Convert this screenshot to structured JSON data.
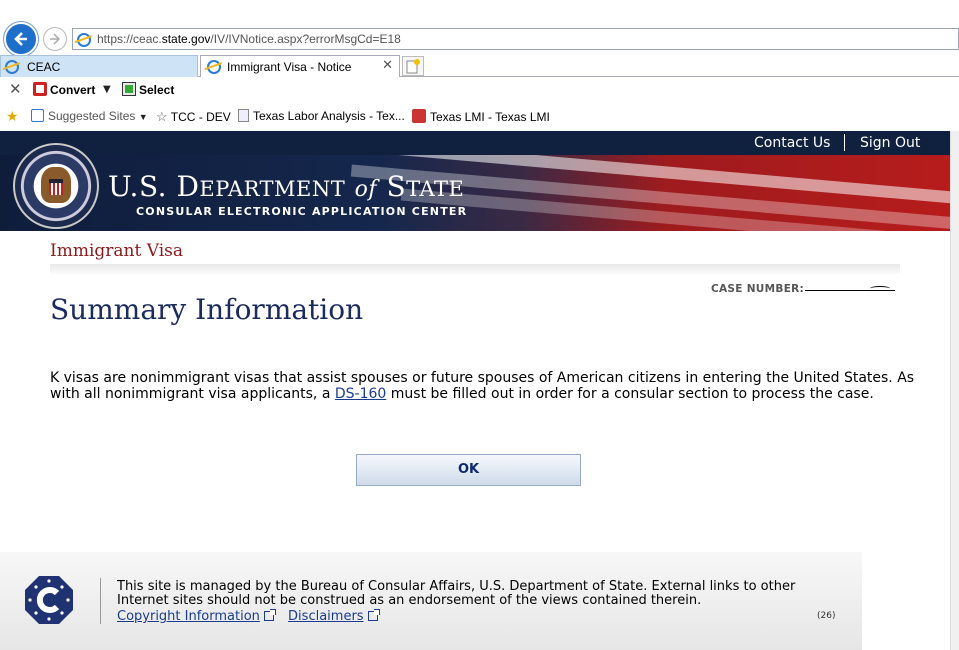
{
  "browser": {
    "url_prefix": "https://ceac.",
    "url_domain": "state.gov",
    "url_path": "/IV/IVNotice.aspx?errorMsgCd=E18",
    "tabs": [
      {
        "label": "CEAC"
      },
      {
        "label": "Immigrant Visa - Notice"
      }
    ],
    "toolbar": {
      "convert_label": "Convert",
      "select_label": "Select"
    },
    "favorites": [
      {
        "label": "Suggested Sites"
      },
      {
        "label": "TCC - DEV"
      },
      {
        "label": "Texas Labor Analysis - Tex..."
      },
      {
        "label": "Texas LMI - Texas LMI"
      }
    ]
  },
  "header": {
    "contact_label": "Contact Us",
    "signout_label": "Sign Out",
    "dept_u": "U",
    "dept_s": "S",
    "dept_D": "D",
    "dept_epartment": "EPARTMENT",
    "dept_of": "of",
    "dept_S2": "S",
    "dept_tate": "TATE",
    "subtitle": "CONSULAR ELECTRONIC APPLICATION CENTER"
  },
  "main": {
    "section": "Immigrant Visa",
    "case_label": "CASE NUMBER:",
    "title": "Summary Information",
    "message_part1": "K visas are nonimmigrant visas that assist spouses or future spouses of American citizens in entering the United States. As with all nonimmigrant visa applicants, a ",
    "message_link": "DS-160",
    "message_part2": " must be filled out in order for a consular section to process the case.",
    "ok_label": "OK"
  },
  "footer": {
    "text": "This site is managed by the Bureau of Consular Affairs, U.S. Department of State. External links to other Internet sites should not be construed as an endorsement of the views contained therein.",
    "copyright_label": "Copyright Information",
    "disclaimers_label": "Disclaimers",
    "code": "(26)"
  },
  "colors": {
    "navy": "#10213f",
    "title_blue": "#1a2b5f",
    "section_red": "#8b1a1a",
    "link": "#1a3c8f"
  }
}
